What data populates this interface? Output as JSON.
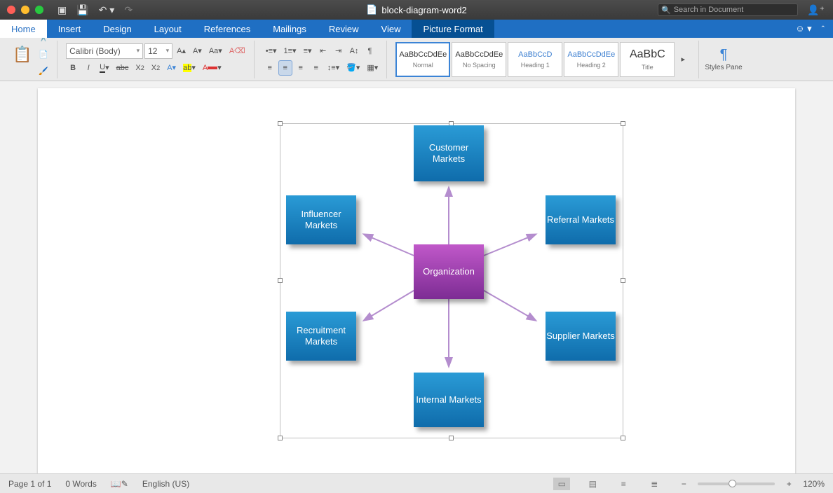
{
  "titlebar": {
    "doc_name": "block-diagram-word2",
    "search_placeholder": "Search in Document"
  },
  "tabs": {
    "home": "Home",
    "insert": "Insert",
    "design": "Design",
    "layout": "Layout",
    "references": "References",
    "mailings": "Mailings",
    "review": "Review",
    "view": "View",
    "picture_format": "Picture Format"
  },
  "ribbon": {
    "paste": "Paste",
    "font_name": "Calibri (Body)",
    "font_size": "12",
    "styles": {
      "normal": {
        "preview": "AaBbCcDdEe",
        "label": "Normal"
      },
      "nospacing": {
        "preview": "AaBbCcDdEe",
        "label": "No Spacing"
      },
      "heading1": {
        "preview": "AaBbCcD",
        "label": "Heading 1"
      },
      "heading2": {
        "preview": "AaBbCcDdEe",
        "label": "Heading 2"
      },
      "title": {
        "preview": "AaBbC",
        "label": "Title"
      }
    },
    "styles_pane": "Styles Pane"
  },
  "diagram": {
    "center": "Organization",
    "top": "Customer Markets",
    "bottom": "Internal Markets",
    "tl": "Influencer Markets",
    "tr": "Referral Markets",
    "bl": "Recruitment Markets",
    "br": "Supplier Markets"
  },
  "status": {
    "page": "Page 1 of 1",
    "words": "0 Words",
    "lang": "English (US)",
    "zoom": "120%"
  }
}
